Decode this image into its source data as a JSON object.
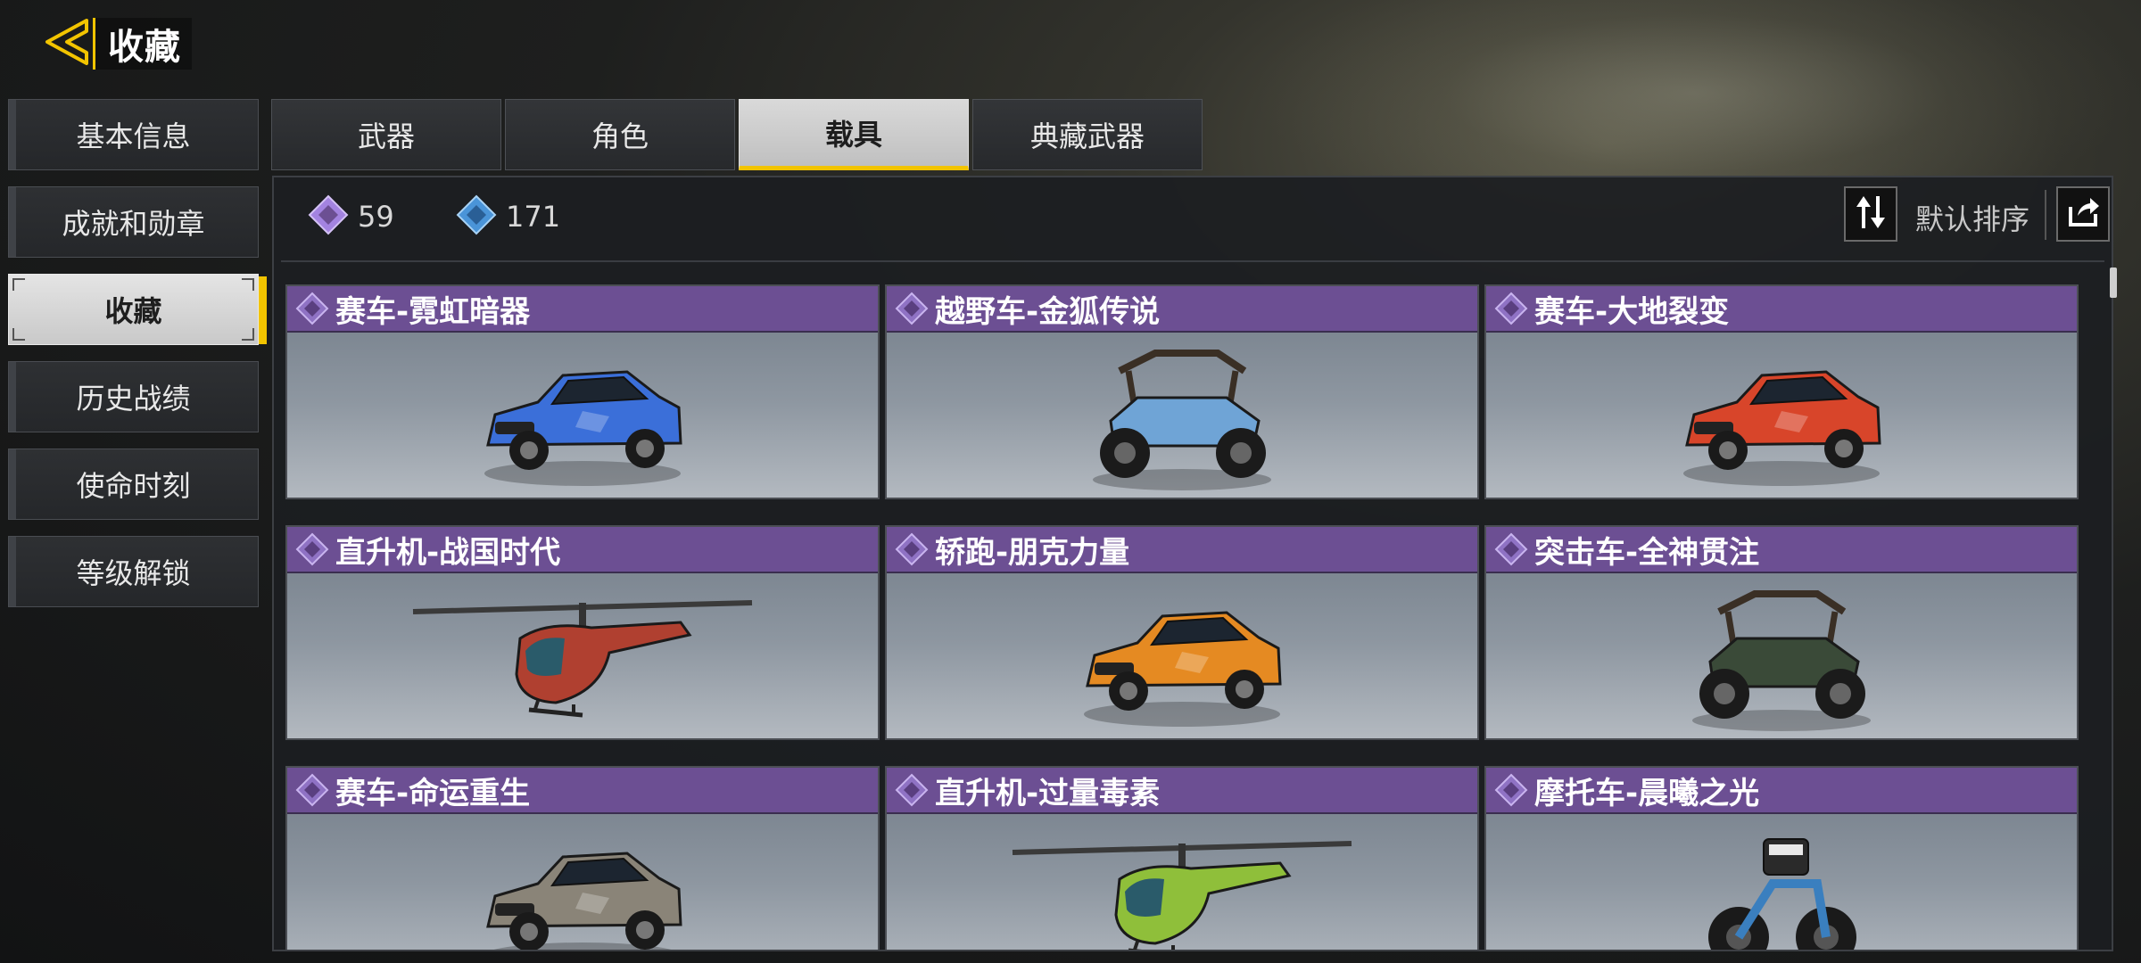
{
  "header": {
    "title": "收藏",
    "back_icon": "back-arrow-icon"
  },
  "sidebar": {
    "items": [
      {
        "label": "基本信息",
        "active": false
      },
      {
        "label": "成就和勋章",
        "active": false
      },
      {
        "label": "收藏",
        "active": true
      },
      {
        "label": "历史战绩",
        "active": false
      },
      {
        "label": "使命时刻",
        "active": false
      },
      {
        "label": "等级解锁",
        "active": false
      }
    ]
  },
  "tabs": [
    {
      "label": "武器",
      "active": false
    },
    {
      "label": "角色",
      "active": false
    },
    {
      "label": "载具",
      "active": true
    },
    {
      "label": "典藏武器",
      "active": false
    }
  ],
  "stats": {
    "purple_count": "59",
    "blue_count": "171",
    "purple_icon": "purple-diamond-icon",
    "blue_icon": "blue-diamond-icon"
  },
  "sort": {
    "label": "默认排序",
    "sort_icon": "sort-arrows-icon",
    "share_icon": "share-icon"
  },
  "colors": {
    "accent": "#f2c400",
    "rarity_purple": "#6c4f93",
    "stat_purple": "#a383e0",
    "stat_blue": "#4a94d8"
  },
  "cards": [
    {
      "name": "赛车-霓虹暗器",
      "type": "car",
      "color": "#3b6fd9"
    },
    {
      "name": "越野车-金狐传说",
      "type": "buggy",
      "color": "#6fa4d6"
    },
    {
      "name": "赛车-大地裂变",
      "type": "car",
      "color": "#d8452a"
    },
    {
      "name": "直升机-战国时代",
      "type": "heli",
      "color": "#b04030"
    },
    {
      "name": "轿跑-朋克力量",
      "type": "car",
      "color": "#e58a22"
    },
    {
      "name": "突击车-全神贯注",
      "type": "buggy",
      "color": "#3a4a38"
    },
    {
      "name": "赛车-命运重生",
      "type": "car",
      "color": "#8a8478"
    },
    {
      "name": "直升机-过量毒素",
      "type": "heli",
      "color": "#8fbf3a"
    },
    {
      "name": "摩托车-晨曦之光",
      "type": "bike",
      "color": "#3a7fbf"
    }
  ]
}
